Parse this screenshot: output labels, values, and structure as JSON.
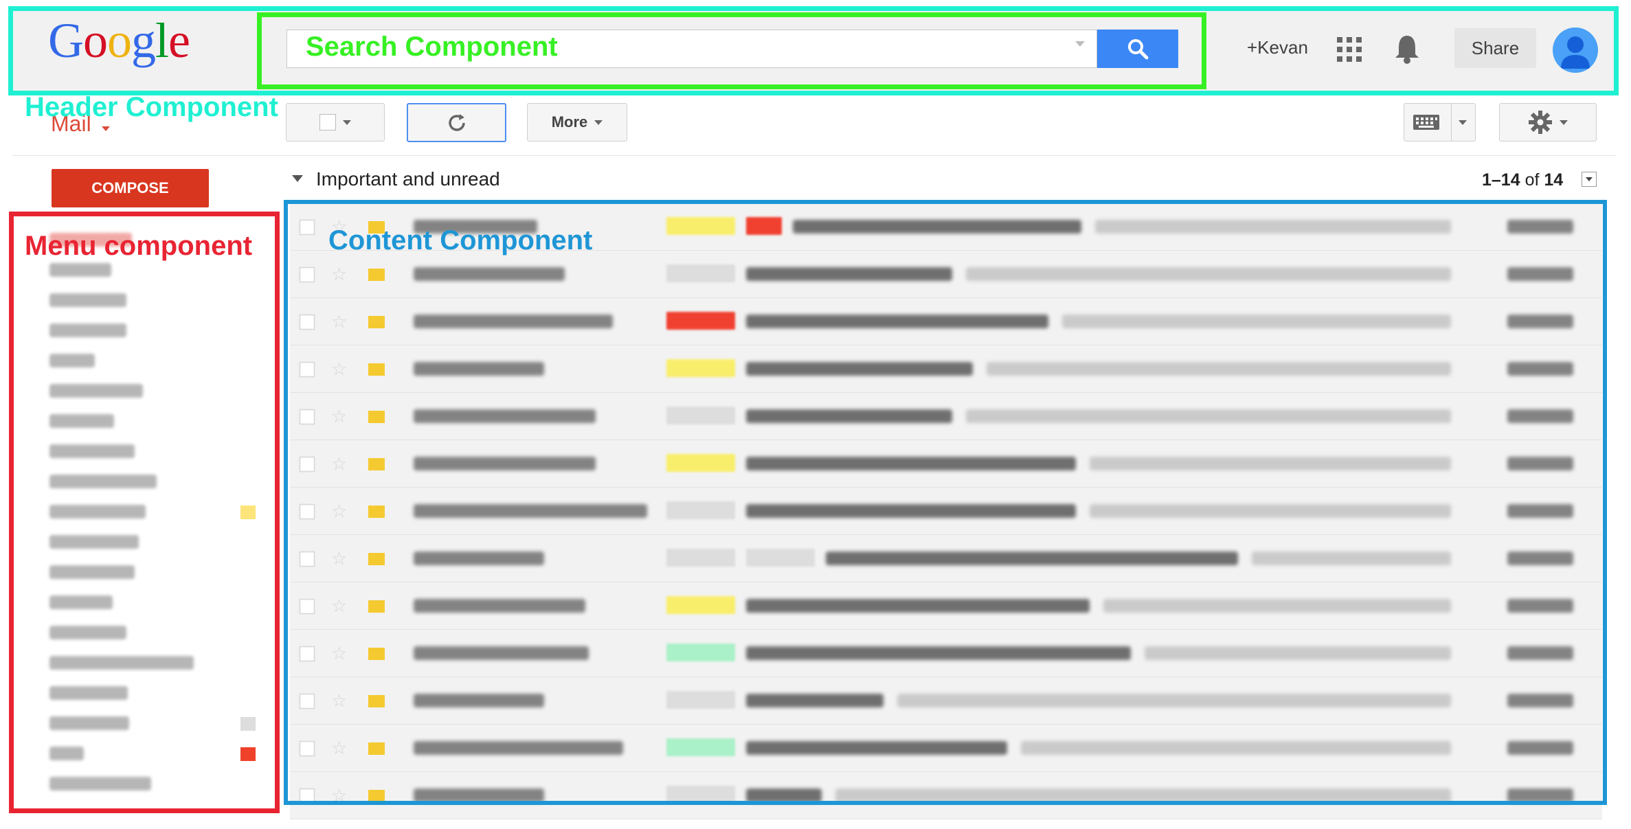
{
  "header": {
    "logo_letters": [
      {
        "ch": "G",
        "color": "#3369e8"
      },
      {
        "ch": "o",
        "color": "#d50f25"
      },
      {
        "ch": "o",
        "color": "#eeb211"
      },
      {
        "ch": "g",
        "color": "#3369e8"
      },
      {
        "ch": "l",
        "color": "#009925"
      },
      {
        "ch": "e",
        "color": "#d50f25"
      }
    ],
    "user_link": "+Kevan",
    "share_label": "Share"
  },
  "annotations": {
    "header_label": "Header Component",
    "search_label": "Search Component",
    "menu_label": "Menu component",
    "content_label": "Content Component"
  },
  "toolbar": {
    "mail_label": "Mail",
    "more_label": "More"
  },
  "compose_label": "COMPOSE",
  "section": {
    "title": "Important and unread",
    "range": "1–14",
    "of_label": "of",
    "total": "14"
  },
  "menu_items": [
    {
      "swatch": null
    },
    {
      "swatch": null
    },
    {
      "swatch": null
    },
    {
      "swatch": null
    },
    {
      "swatch": null
    },
    {
      "swatch": null
    },
    {
      "swatch": null
    },
    {
      "swatch": null
    },
    {
      "swatch": null
    },
    {
      "swatch": "#fde47a"
    },
    {
      "swatch": null
    },
    {
      "swatch": null
    },
    {
      "swatch": null
    },
    {
      "swatch": null
    },
    {
      "swatch": null
    },
    {
      "swatch": null
    },
    {
      "swatch": "#dddddd"
    },
    {
      "swatch": "#f0412b"
    },
    {
      "swatch": null
    }
  ],
  "emails": [
    {
      "tags": [
        "#f9ee6b",
        "#f04030"
      ],
      "flag": "#f4ca30"
    },
    {
      "tags": [
        "#dddddd"
      ],
      "flag": "#f4ca30"
    },
    {
      "tags": [
        "#f04030"
      ],
      "flag": "#f4ca30"
    },
    {
      "tags": [
        "#f9ee6b"
      ],
      "flag": "#f4ca30"
    },
    {
      "tags": [
        "#dddddd"
      ],
      "flag": "#f4ca30"
    },
    {
      "tags": [
        "#f9ee6b"
      ],
      "flag": "#f4ca30"
    },
    {
      "tags": [
        "#dddddd"
      ],
      "flag": "#f4ca30"
    },
    {
      "tags": [
        "#dddddd",
        "#dddddd"
      ],
      "flag": "#f4ca30"
    },
    {
      "tags": [
        "#f9ee6b"
      ],
      "flag": "#f4ca30"
    },
    {
      "tags": [
        "#aaf0c8"
      ],
      "flag": "#f4ca30"
    },
    {
      "tags": [
        "#dddddd"
      ],
      "flag": "#f4ca30"
    },
    {
      "tags": [
        "#aaf0c8"
      ],
      "flag": "#f4ca30"
    },
    {
      "tags": [
        "#dddddd"
      ],
      "flag": "#f4ca30"
    }
  ],
  "icons": {
    "search": "search-icon",
    "refresh": "refresh-icon",
    "apps": "apps-grid-icon",
    "bell": "bell-icon",
    "keyboard": "keyboard-icon",
    "settings": "gear-icon",
    "avatar": "user-avatar-icon"
  }
}
